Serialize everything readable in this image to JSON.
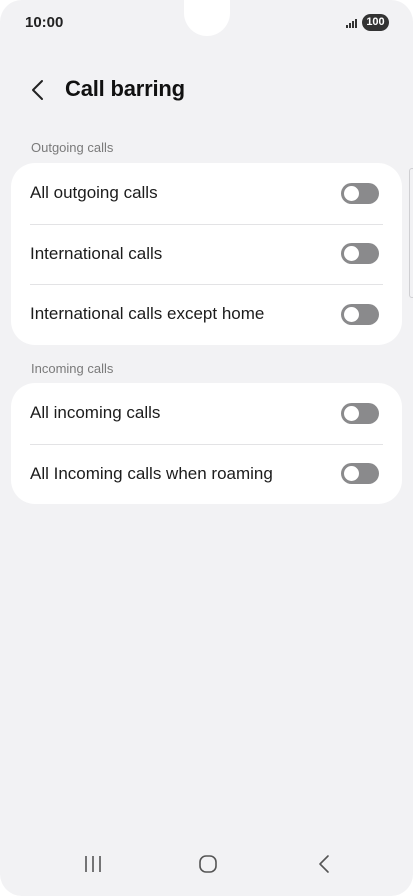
{
  "status_bar": {
    "time": "10:00",
    "battery": "100",
    "signal_icon": "signal-bars-icon"
  },
  "header": {
    "back_icon": "chevron-left-icon",
    "title": "Call barring"
  },
  "sections": [
    {
      "label": "Outgoing calls",
      "items": [
        {
          "label": "All outgoing calls",
          "enabled": false
        },
        {
          "label": "International calls",
          "enabled": false
        },
        {
          "label": "International calls except home",
          "enabled": false
        }
      ]
    },
    {
      "label": "Incoming calls",
      "items": [
        {
          "label": "All incoming calls",
          "enabled": false
        },
        {
          "label": "All Incoming calls when roaming",
          "enabled": false
        }
      ]
    }
  ],
  "nav_bar": {
    "recents_icon": "recent-apps-icon",
    "home_icon": "home-icon",
    "back_icon": "back-icon"
  },
  "colors": {
    "background": "#f2f2f4",
    "card": "#ffffff",
    "toggle_off": "#8a8a8c",
    "text_secondary": "#7a7a7a"
  }
}
